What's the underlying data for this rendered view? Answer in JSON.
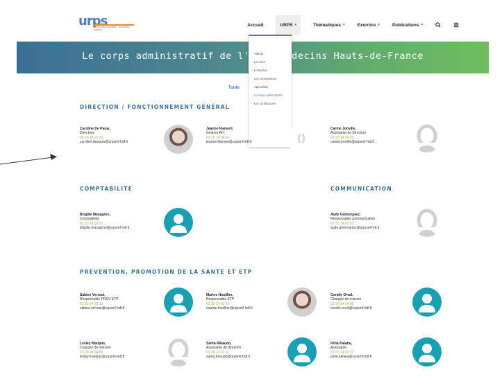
{
  "brand": {
    "logo_text": "urps",
    "logo_sub": "médecins libéraux · hauts-de-france"
  },
  "nav": {
    "items": [
      {
        "label": "Accueil",
        "caret": ""
      },
      {
        "label": "URPS",
        "caret": "▾"
      },
      {
        "label": "Thématiques",
        "caret": "▾"
      },
      {
        "label": "Exercice",
        "caret": "▾"
      },
      {
        "label": "Publications",
        "caret": "▾"
      }
    ],
    "search_icon": "search-icon",
    "menu_icon": "menu-icon"
  },
  "banner": {
    "title": "Le corps administratif de l'URPS Médecins Hauts-de-France"
  },
  "dropdown": {
    "items": [
      "Statuts",
      "Les élus",
      "Le bureau",
      "Les commissions",
      "Spécialités",
      "Le corps administratif",
      "Les conférences"
    ]
  },
  "filter": {
    "label": "Toute"
  },
  "sections": {
    "direction": "DIRECTION / FONCTIONNEMENT GÉNÉRAL",
    "compta": "COMPTABILITE",
    "communication": "COMMUNICATION",
    "prevention": "PREVENTION, PROMOTION DE LA SANTE ET ETP"
  },
  "people": {
    "caroline": {
      "name": "Caroline De Pauw,",
      "role": "Directrice",
      "phone": "03 20 14 22 22",
      "email": "caroline.depauw@urpsml-hdf.fr"
    },
    "jeanne": {
      "name": "Jeanne Flament,",
      "role": "Gestion RH",
      "phone": "03 20 14 94 56",
      "email": "jeanne.flament@urpsml-hdf.fr"
    },
    "carine": {
      "name": "Carine Jonville,",
      "role": "Assistante de Direction",
      "phone": "03 20 14 94 30",
      "email": "carine.jonville@urpsml-hdf.fr"
    },
    "brigitte": {
      "name": "Brigitte Masagron,",
      "role": "Comptabilité",
      "phone": "03 20 14 93 20",
      "email": "brigitte.masagron@urpsml-hdf.fr"
    },
    "aude": {
      "name": "Aude Grimonprez,",
      "role": "Responsable communication",
      "phone": "03 20 14 93 32",
      "email": "aude.grimonprez@urpsml-hdf.fr"
    },
    "sabine": {
      "name": "Sabine Verrout,",
      "role": "Responsable PREV-ETP",
      "phone": "03 20 14 93 15",
      "email": "sabine.verrout@urpsml-hdf.fr"
    },
    "marine": {
      "name": "Marine Houillier,",
      "role": "Responsable ETP",
      "phone": "03 20 14 93 36",
      "email": "marine.houillier@urpsml-hdf.fr"
    },
    "coralie": {
      "name": "Coralie Orval,",
      "role": "Chargée de mission",
      "phone": "03 20 14 94 95",
      "email": "coralie.orval@urpsml-hdf.fr"
    },
    "lesley": {
      "name": "Lesley Marquis,",
      "role": "Chargée de mission",
      "phone": "03 20 14 94 59",
      "email": "lesley.marquis@urpsml-hdf.fr"
    },
    "santa": {
      "name": "Santa Ribaudo,",
      "role": "Assistante de direction",
      "phone": "03 20 14 93 11",
      "email": "santa.ribaudo@urpsml-hdf.fr"
    },
    "pelia": {
      "name": "Pélia Kalana,",
      "role": "Assistante",
      "phone": "03 20 14 93 97",
      "email": "pelia.kalana@urpsml-hdf.fr"
    }
  },
  "colors": {
    "accent": "#3d6e96",
    "teal_avatar": "#1aa0b5",
    "phone": "#8cbf4a",
    "banner_start": "#3a6f95",
    "banner_end": "#6fbd5e"
  }
}
